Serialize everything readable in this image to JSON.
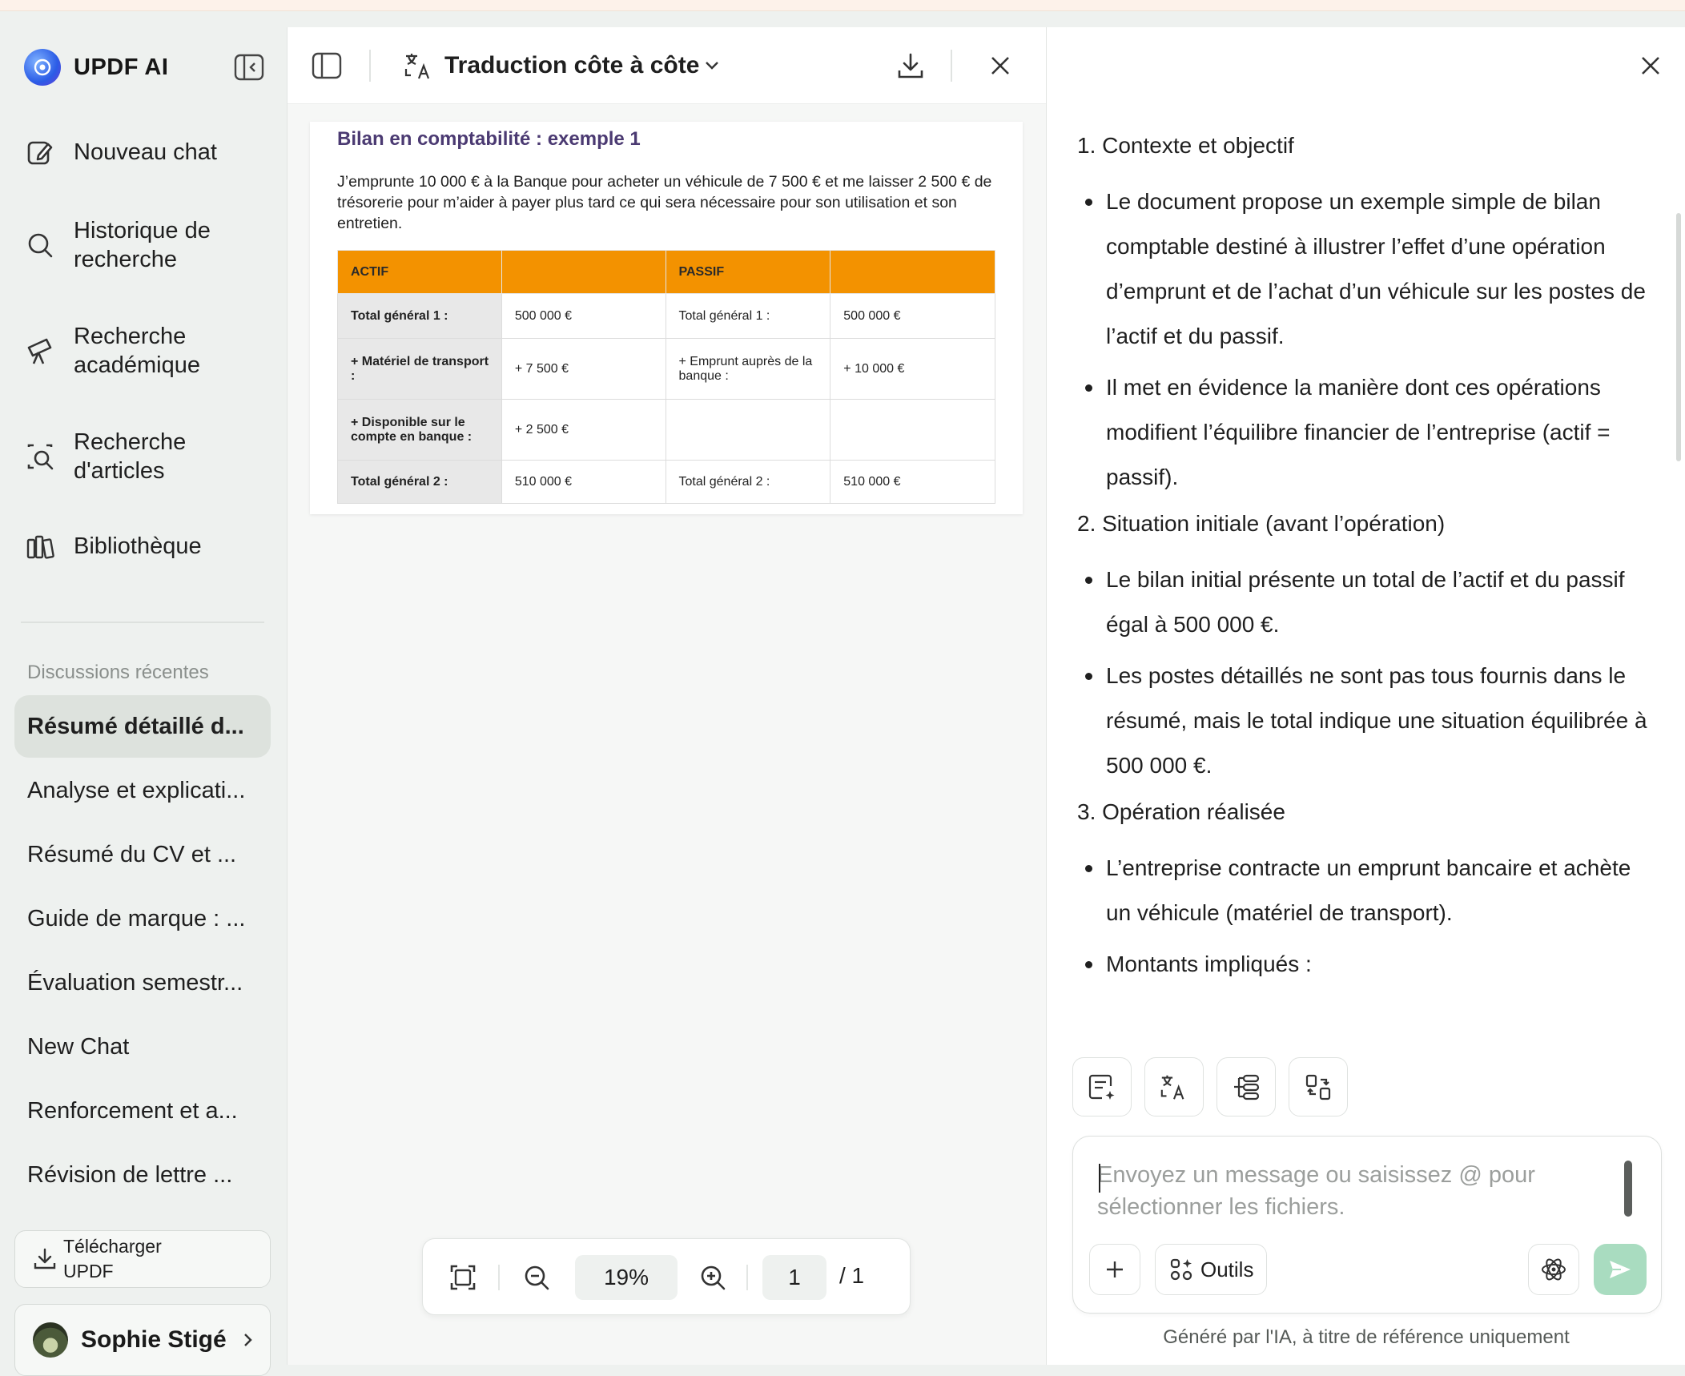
{
  "sidebar": {
    "brand": "UPDF AI",
    "nav": [
      {
        "label": "Nouveau chat",
        "icon": "new-chat-icon"
      },
      {
        "label": "Historique de recherche",
        "icon": "search-icon"
      },
      {
        "label": "Recherche académique",
        "icon": "telescope-icon"
      },
      {
        "label": "Recherche d'articles",
        "icon": "article-search-icon"
      },
      {
        "label": "Bibliothèque",
        "icon": "library-icon"
      }
    ],
    "recent_title": "Discussions récentes",
    "recent": [
      "Résumé détaillé d...",
      "Analyse et explicati...",
      "Résumé du CV et ...",
      "Guide de marque : ...",
      "Évaluation semestr...",
      "New Chat",
      "Renforcement et a...",
      "Révision de lettre ..."
    ],
    "download_label": "Télécharger UPDF",
    "user_name": "Sophie Stigé"
  },
  "doc": {
    "mode_title": "Traduction côte à côte",
    "page_title": "Bilan en comptabilité : exemple 1",
    "page_text": "J’emprunte 10 000 € à la Banque pour acheter un véhicule de 7 500 € et me laisser 2 500 € de trésorerie pour m’aider à payer plus tard ce qui sera nécessaire pour son utilisation et son entretien.",
    "table": {
      "headers": [
        "ACTIF",
        "",
        "PASSIF",
        ""
      ],
      "rows": [
        [
          "Total général 1 :",
          "500 000 €",
          "Total général 1 :",
          "500 000 €"
        ],
        [
          "+ Matériel de transport :",
          "+ 7 500 €",
          "+ Emprunt auprès de la banque :",
          "+ 10 000 €"
        ],
        [
          "+ Disponible sur le compte en banque :",
          "+ 2 500 €",
          "",
          ""
        ],
        [
          "Total général  2 :",
          "510 000 €",
          "Total général  2 :",
          "510 000 €"
        ]
      ]
    },
    "zoom": "19%",
    "page_current": "1",
    "page_total": "/  1"
  },
  "ai": {
    "sections": [
      {
        "heading": "1. Contexte et objectif",
        "bullets": [
          "Le document propose un exemple simple de bilan comptable destiné à illustrer l’effet d’une opération d’emprunt et de l’achat d’un véhicule sur les postes de l’actif et du passif.",
          "Il met en évidence la manière dont ces opérations modifient l’équilibre financier de l’entreprise (actif = passif)."
        ]
      },
      {
        "heading": "2. Situation initiale (avant l’opération)",
        "bullets": [
          "Le bilan initial présente un total de l’actif et du passif égal à 500 000 €.",
          "Les postes détaillés ne sont pas tous fournis dans le résumé, mais le total indique une situation équilibrée à 500 000 €."
        ]
      },
      {
        "heading": "3. Opération réalisée",
        "bullets": [
          "L’entreprise contracte un emprunt bancaire et achète un véhicule (matériel de transport).",
          "Montants impliqués :"
        ]
      }
    ],
    "input_placeholder": "Envoyez un message ou saisissez @ pour sélectionner les fichiers.",
    "tools_label": "Outils",
    "disclaimer": "Généré par l'IA, à titre de référence uniquement"
  },
  "colors": {
    "accent_green": "#a9dcc0",
    "table_header": "#f39200",
    "doc_title": "#4b3a72"
  }
}
